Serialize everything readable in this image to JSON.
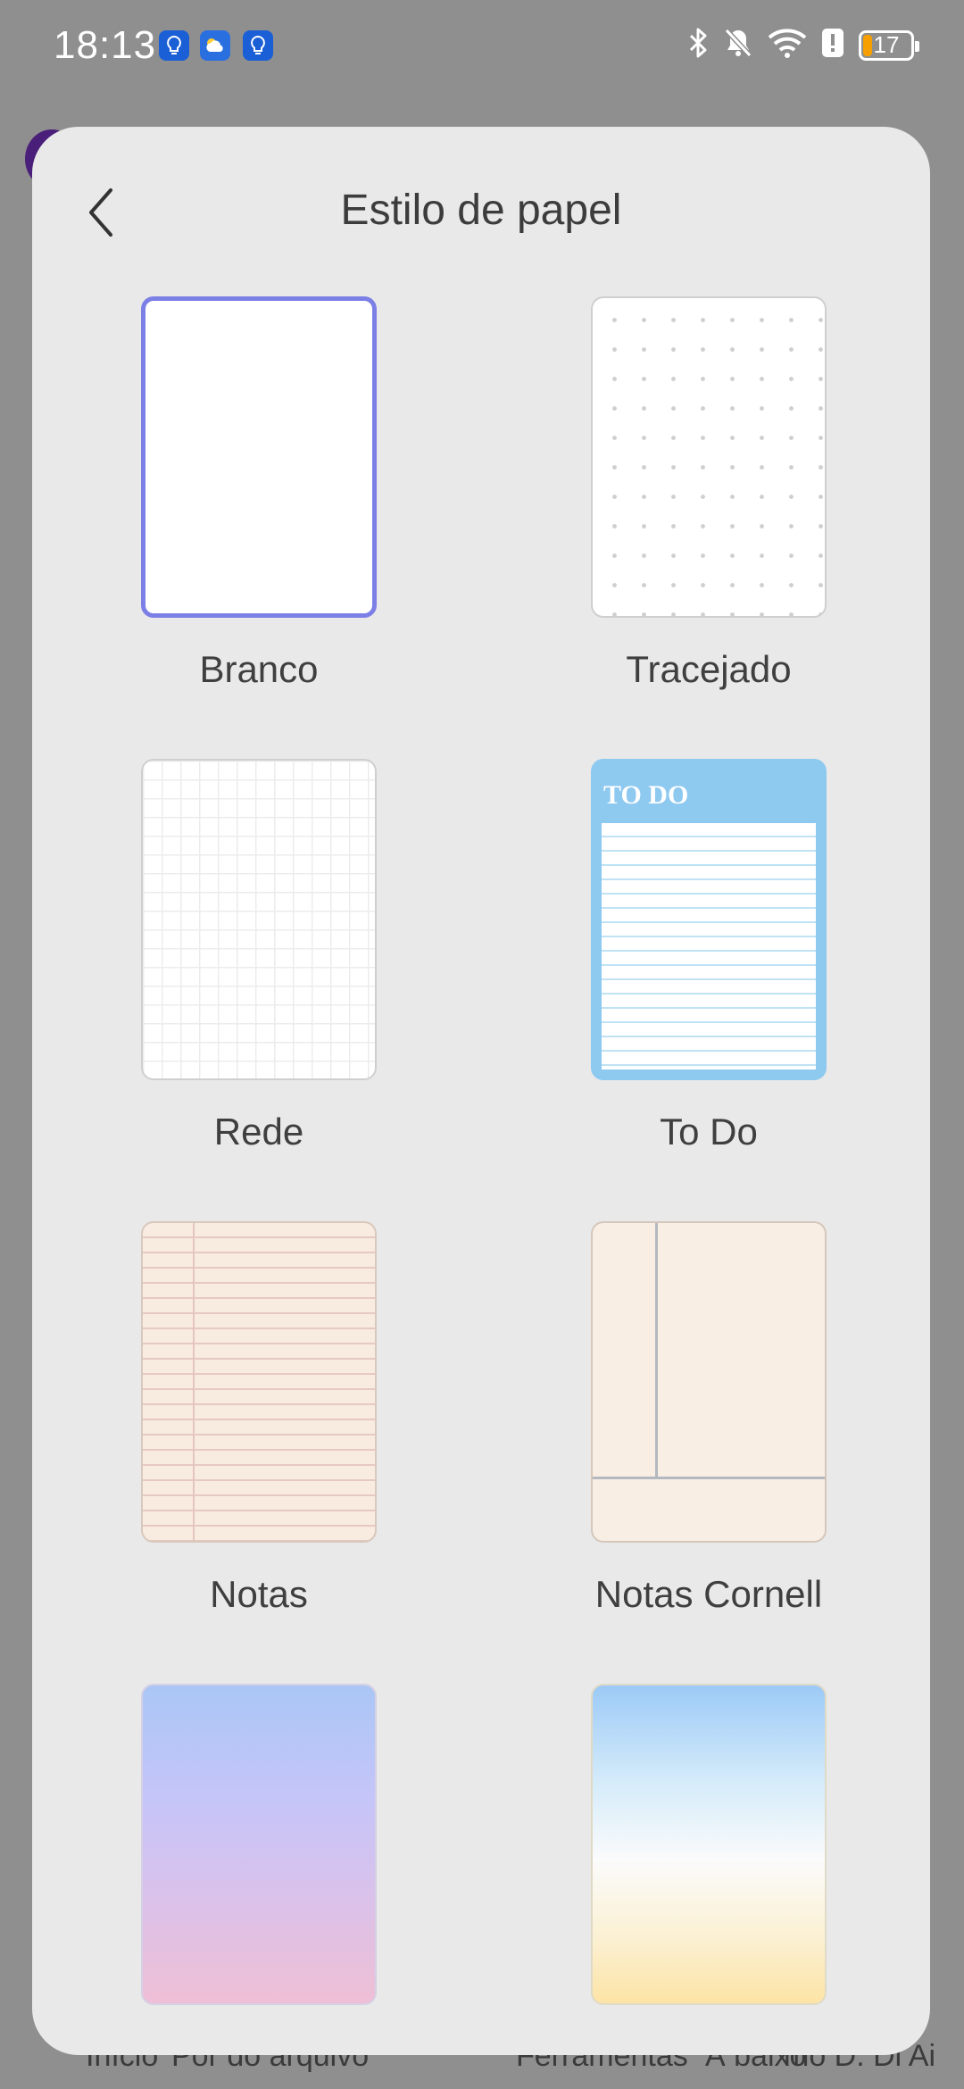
{
  "status_bar": {
    "time": "18:13",
    "battery_level": "17",
    "battery_fraction": 0.17,
    "battery_color": "#f5a000",
    "icons": [
      "lightbulb-icon",
      "weather-icon",
      "lightbulb-icon",
      "bluetooth-icon",
      "bell-muted-icon",
      "wifi-icon",
      "alert-icon",
      "battery-icon"
    ]
  },
  "sheet": {
    "title": "Estilo de papel",
    "back_icon": "chevron-left-icon",
    "selected_accent": "#7b7fe6"
  },
  "papers": [
    {
      "label": "Branco",
      "selected": true
    },
    {
      "label": "Tracejado",
      "selected": false
    },
    {
      "label": "Rede",
      "selected": false
    },
    {
      "label": "To Do",
      "selected": false,
      "preview_heading": "TO DO"
    },
    {
      "label": "Notas",
      "selected": false
    },
    {
      "label": "Notas Cornell",
      "selected": false
    },
    {
      "label": "",
      "selected": false
    },
    {
      "label": "",
      "selected": false
    }
  ],
  "background_nav": {
    "items": [
      "Início",
      "Pôr do arquivo",
      "Ferramentas",
      "À baixo",
      "mo D. Di Ai"
    ]
  }
}
